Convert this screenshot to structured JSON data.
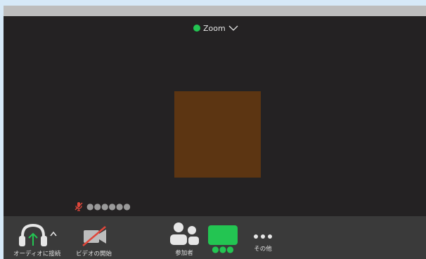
{
  "header": {
    "meeting_title": "Zoom"
  },
  "stage": {
    "participant_name": "●●●●●●"
  },
  "toolbar": {
    "audio_label": "オーディオに接続",
    "video_label": "ビデオの開始",
    "participants_label": "参加者",
    "share_label": "●●●",
    "more_label": "その他"
  },
  "colors": {
    "accent_green": "#23c552",
    "tile_brown": "#5c3512",
    "muted_red": "#e0463a",
    "background": "#242223",
    "toolbar": "#3a3a3a"
  }
}
